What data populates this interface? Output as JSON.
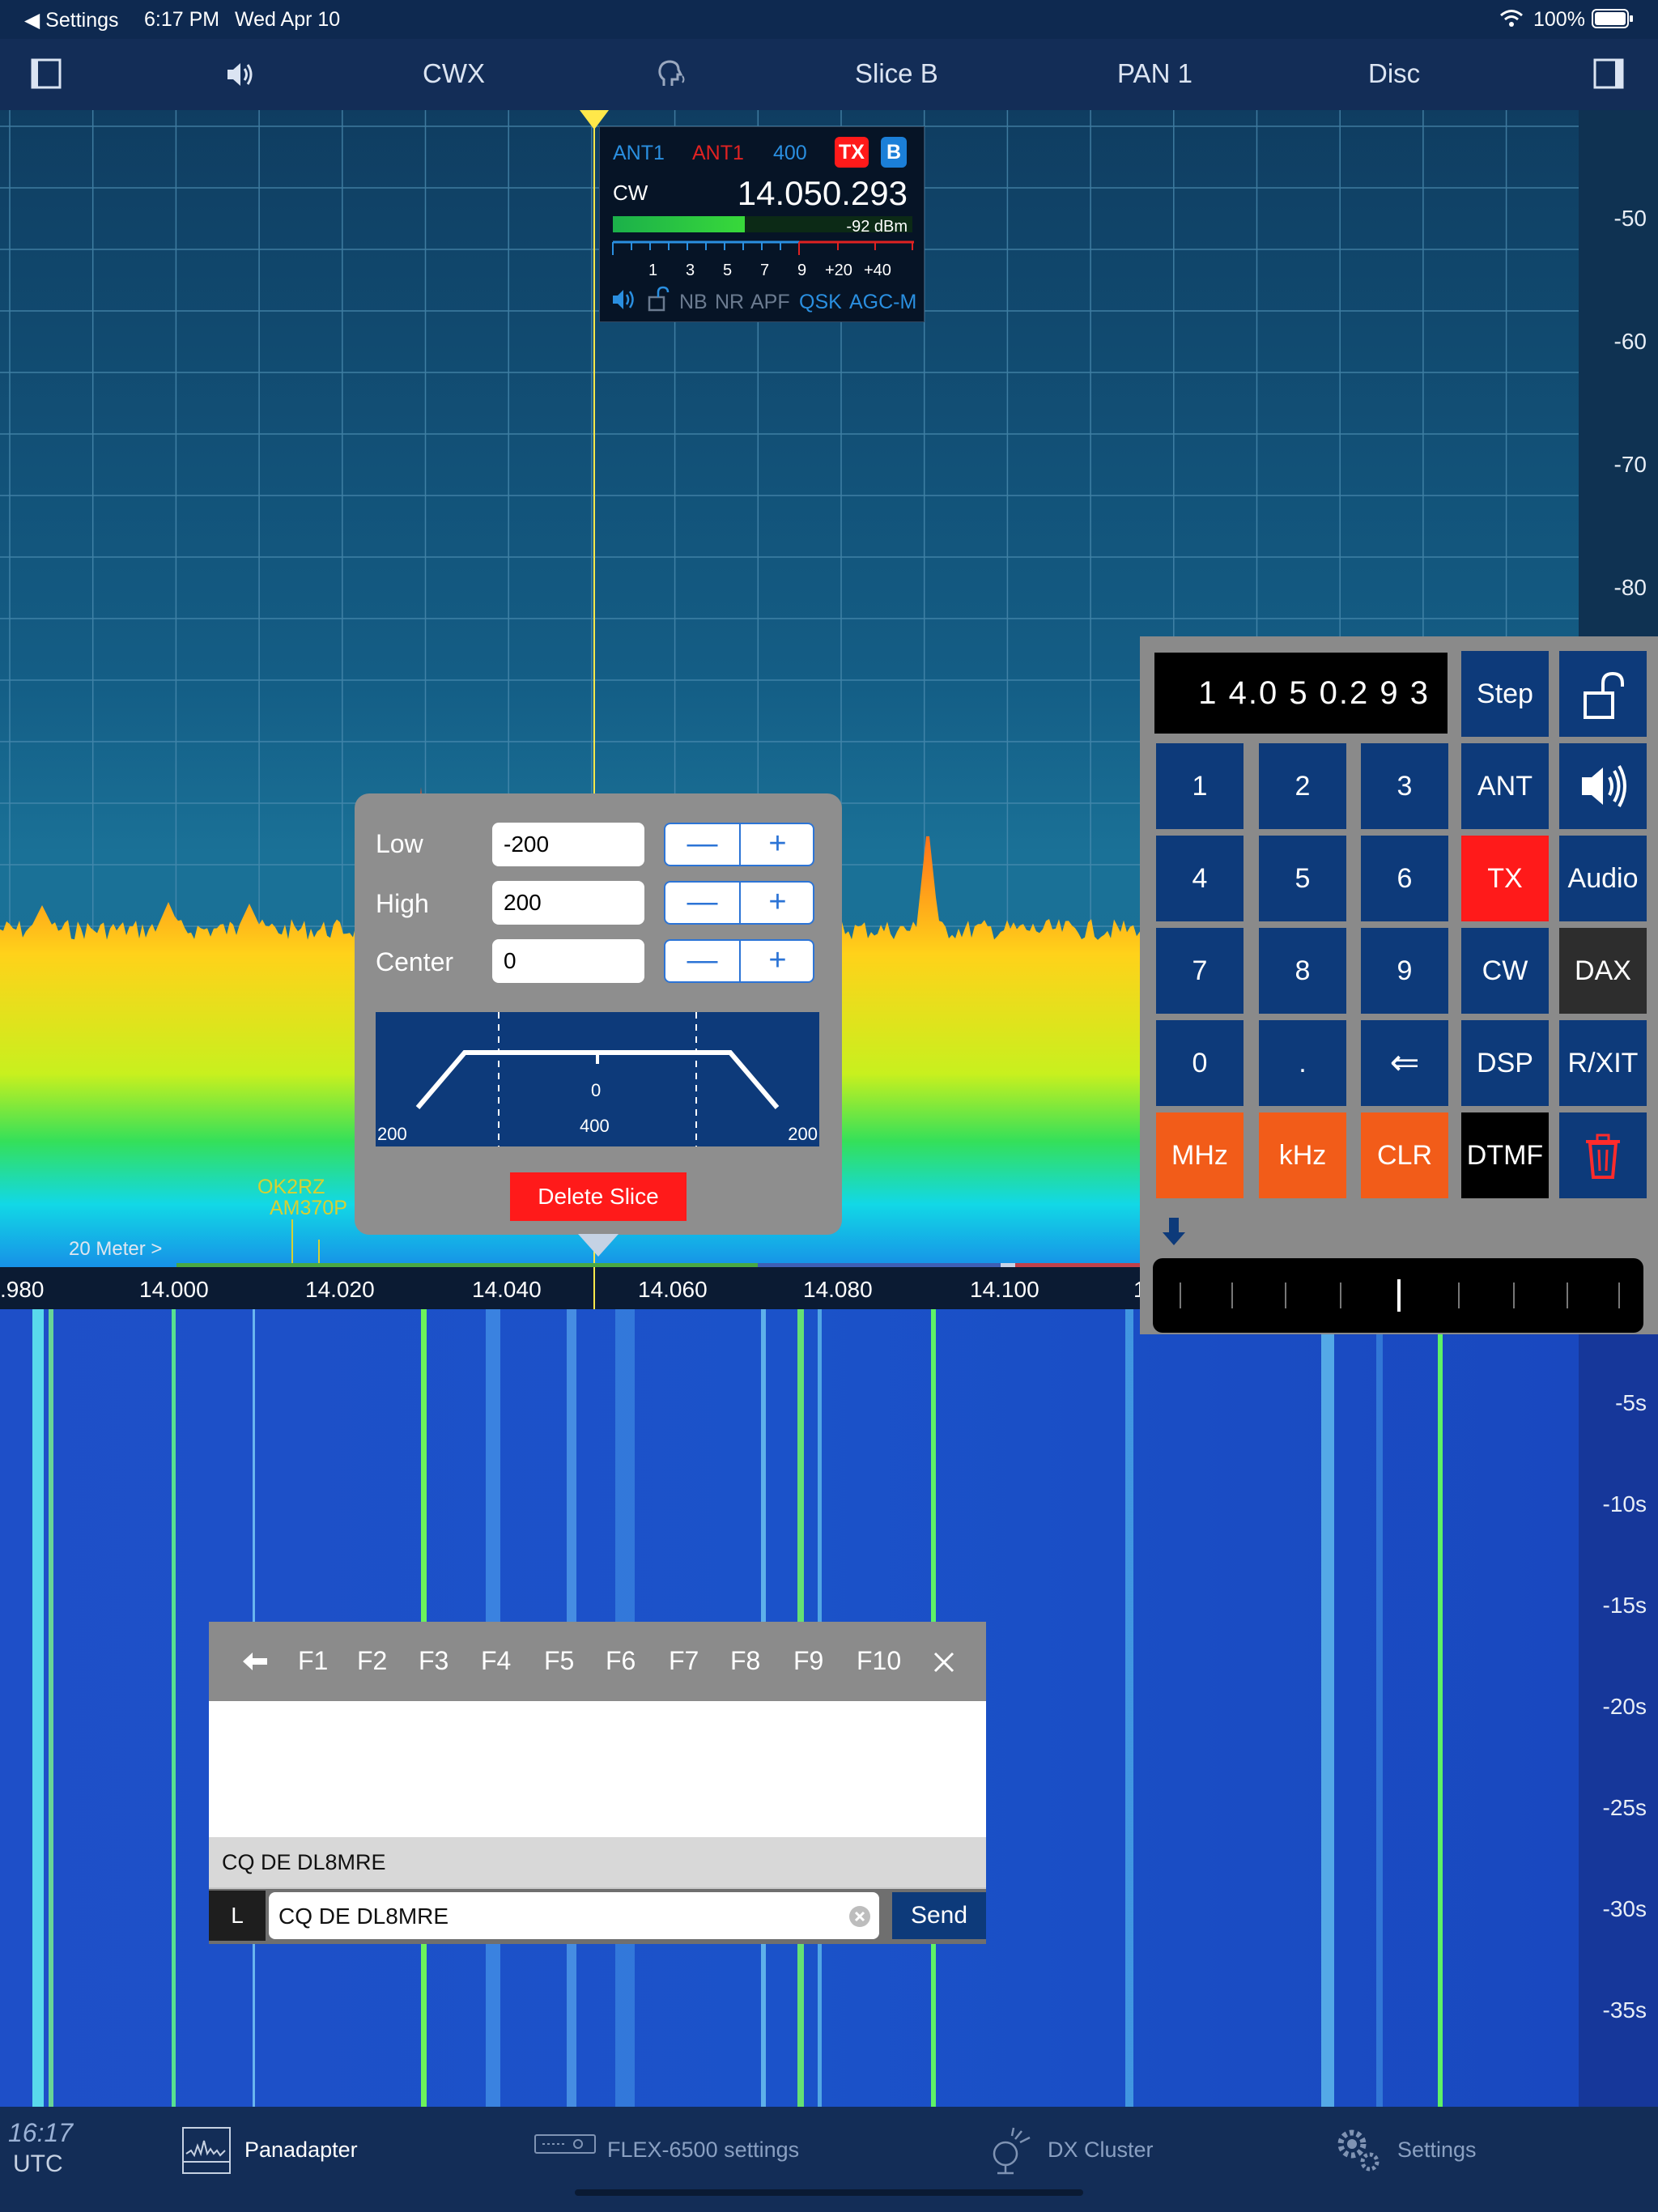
{
  "status_bar": {
    "back": "◀ Settings",
    "time": "6:17 PM",
    "date": "Wed Apr 10",
    "battery": "100%"
  },
  "toolbar": {
    "mode": "CWX",
    "slice": "Slice B",
    "pan": "PAN 1",
    "disc": "Disc"
  },
  "panadapter": {
    "dbm_labels": [
      "-50",
      "-60",
      "-70",
      "-80"
    ],
    "freq_labels": [
      ".980",
      "14.000",
      "14.020",
      "14.040",
      "14.060",
      "14.080",
      "14.100",
      "1"
    ],
    "band_label": "20 Meter >",
    "spots": [
      "OK2RZ",
      "AM370P"
    ],
    "colors": {
      "grid": "#3c7a9e",
      "band_green": "#4aa843",
      "band_blue": "#3e5fb5",
      "band_red": "#c0414b"
    }
  },
  "slice_flag": {
    "rx_ant": "ANT1",
    "tx_ant": "ANT1",
    "filter": "400",
    "tx_badge": "TX",
    "slice_badge": "B",
    "mode": "CW",
    "frequency": "14.050.293",
    "signal": "-92 dBm",
    "s_scale": [
      "1",
      "3",
      "5",
      "7",
      "9",
      "+20",
      "+40"
    ],
    "s_meter_fraction": 0.44,
    "dsp_flags": [
      "NB",
      "NR",
      "APF",
      "QSK",
      "AGC-M"
    ]
  },
  "filter_popup": {
    "low_label": "Low",
    "low_value": "-200",
    "high_label": "High",
    "high_value": "200",
    "center_label": "Center",
    "center_value": "0",
    "diagram": {
      "center": "0",
      "width": "400",
      "left": "200",
      "right": "200"
    },
    "delete_label": "Delete Slice"
  },
  "keypad": {
    "display": "1 4.0 5 0.2 9 3",
    "step": "Step",
    "keys": {
      "k1": "1",
      "k2": "2",
      "k3": "3",
      "k4": "4",
      "k5": "5",
      "k6": "6",
      "k7": "7",
      "k8": "8",
      "k9": "9",
      "k0": "0",
      "dot": ".",
      "backspace": "⇐",
      "mhz": "MHz",
      "khz": "kHz",
      "clr": "CLR",
      "ant": "ANT",
      "tx": "TX",
      "cw": "CW",
      "dsp": "DSP",
      "dtmf": "DTMF",
      "audio": "Audio",
      "dax": "DAX",
      "rxit": "R/XIT"
    },
    "colors": {
      "key": "#0d3a7a",
      "orange": "#f25c19",
      "red": "#ff1a1a",
      "dark": "#2d2d2d"
    }
  },
  "waterfall": {
    "time_labels": [
      "-5s",
      "-10s",
      "-15s",
      "-20s",
      "-25s",
      "-30s",
      "-35s"
    ]
  },
  "cw_panel": {
    "fkeys": [
      "F1",
      "F2",
      "F3",
      "F4",
      "F5",
      "F6",
      "F7",
      "F8",
      "F9",
      "F10"
    ],
    "sent_text": "CQ DE DL8MRE",
    "l_label": "L",
    "input_value": "CQ DE DL8MRE",
    "send_label": "Send"
  },
  "tab_bar": {
    "clock": "16:17",
    "utc": "UTC",
    "panadapter": "Panadapter",
    "radio_settings": "FLEX-6500 settings",
    "dx_cluster": "DX Cluster",
    "settings": "Settings"
  }
}
